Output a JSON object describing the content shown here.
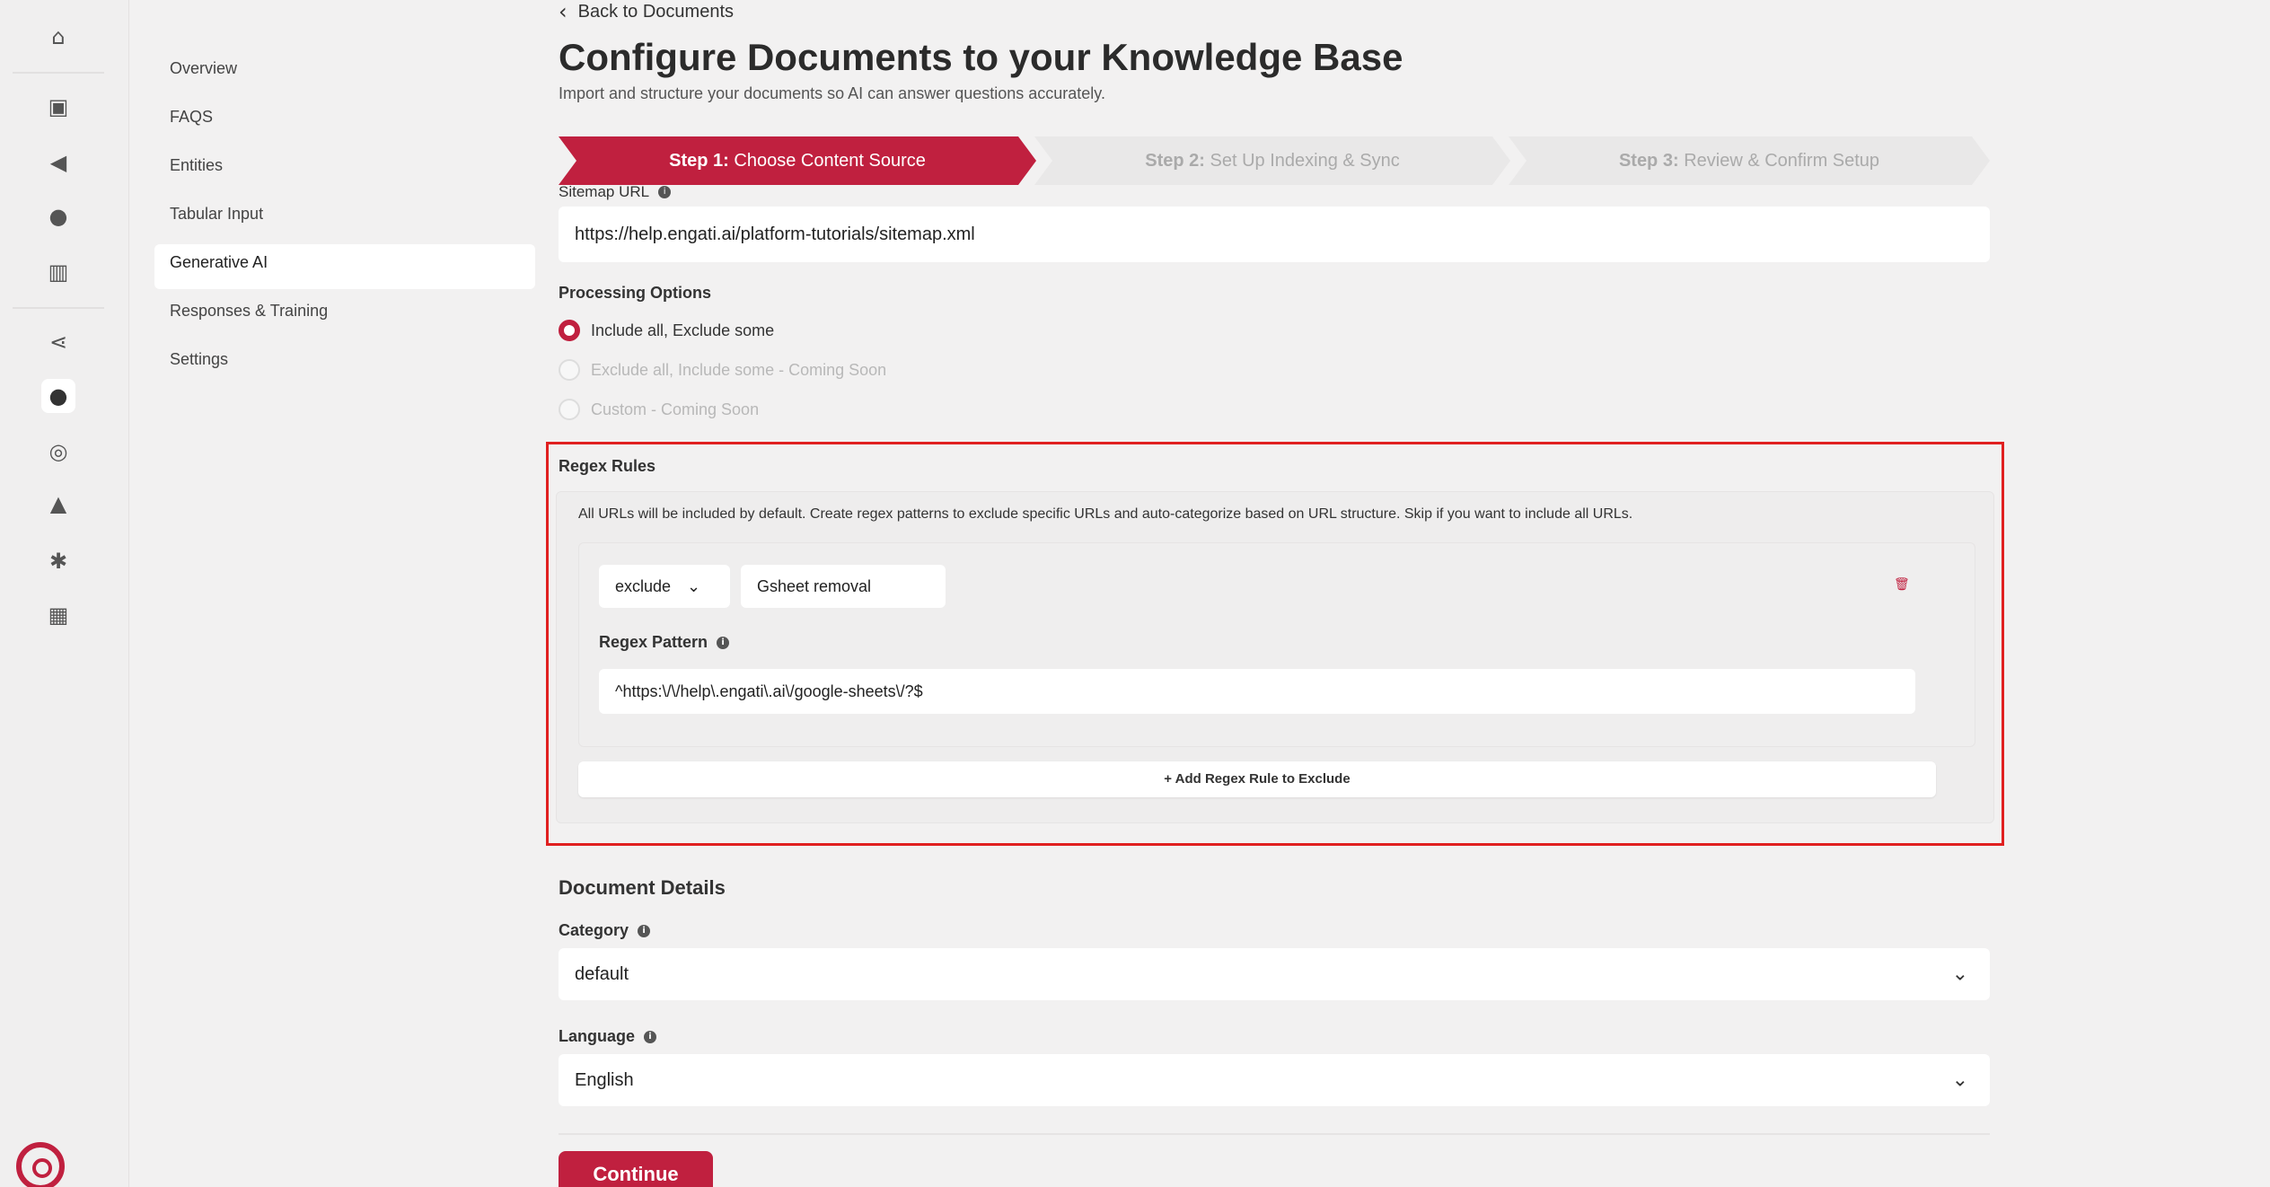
{
  "rail": {
    "icons": [
      "home-icon",
      "chat-icon",
      "megaphone-icon",
      "users-icon",
      "bar-chart-icon",
      "flow-icon",
      "lightbulb-icon",
      "compass-icon",
      "hierarchy-icon",
      "gear-icon",
      "dashboard-icon"
    ]
  },
  "subnav": {
    "items": [
      "Overview",
      "FAQS",
      "Entities",
      "Tabular Input",
      "Generative AI",
      "Responses & Training",
      "Settings"
    ]
  },
  "main": {
    "back_label": "Back to Documents",
    "title": "Configure Documents to your Knowledge Base",
    "subtitle": "Import and structure your documents so AI can answer questions accurately.",
    "steps": [
      {
        "prefix": "Step 1:",
        "label": "Choose Content Source"
      },
      {
        "prefix": "Step 2:",
        "label": "Set Up Indexing & Sync"
      },
      {
        "prefix": "Step 3:",
        "label": "Review & Confirm Setup"
      }
    ],
    "sitemap_label": "Sitemap URL",
    "sitemap_value": "https://help.engati.ai/platform-tutorials/sitemap.xml",
    "processing_label": "Processing Options",
    "processing_options": [
      "Include all, Exclude some",
      "Exclude all, Include some - Coming Soon",
      "Custom - Coming Soon"
    ],
    "regex": {
      "title": "Regex Rules",
      "help": "All URLs will be included by default. Create regex patterns to exclude specific URLs and auto-categorize based on URL structure. Skip if you want to include all URLs.",
      "mode": "exclude",
      "rule_name": "Gsheet removal",
      "pattern_label": "Regex Pattern",
      "pattern_value": "^https:\\/\\/help\\.engati\\.ai\\/google-sheets\\/?$",
      "add_label": "+ Add Regex Rule to Exclude"
    },
    "document_details": {
      "title": "Document Details",
      "category_label": "Category",
      "category_value": "default",
      "language_label": "Language",
      "language_value": "English"
    },
    "continue_label": "Continue"
  },
  "colors": {
    "accent": "#c0203f",
    "highlight_border": "#e02020"
  }
}
